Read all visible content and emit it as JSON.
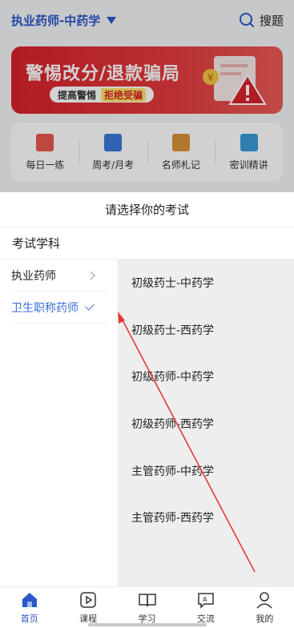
{
  "header": {
    "exam_title": "执业药师-中药学",
    "search_label": "搜题"
  },
  "banner": {
    "title": "警惕改分/退款骗局",
    "pill_text": "提高警惕",
    "pill_highlight": "拒绝受骗"
  },
  "quick_menu": [
    {
      "label": "每日一练",
      "icon": "calendar-practice-icon",
      "color": "#e8584e"
    },
    {
      "label": "周考/月考",
      "icon": "mock-exam-icon",
      "color": "#3a78d8"
    },
    {
      "label": "名师札记",
      "icon": "notes-book-icon",
      "color": "#d9923a"
    },
    {
      "label": "密训精讲",
      "icon": "lecture-icon",
      "color": "#3a9ad8"
    }
  ],
  "sheet": {
    "title": "请选择你的考试",
    "section_title": "考试学科",
    "categories": [
      {
        "label": "执业药师",
        "state": "collapsed"
      },
      {
        "label": "卫生职称药师",
        "state": "selected"
      }
    ],
    "exams": [
      "初级药士-中药学",
      "初级药士-西药学",
      "初级药师-中药学",
      "初级药师-西药学",
      "主管药师-中药学",
      "主管药师-西药学"
    ]
  },
  "tabbar": [
    {
      "label": "首页",
      "icon": "home-icon",
      "active": true
    },
    {
      "label": "课程",
      "icon": "play-course-icon",
      "active": false
    },
    {
      "label": "学习",
      "icon": "open-book-icon",
      "active": false
    },
    {
      "label": "交流",
      "icon": "chat-icon",
      "active": false
    },
    {
      "label": "我的",
      "icon": "person-icon",
      "active": false
    }
  ],
  "colors": {
    "accent": "#2a58c9",
    "selected": "#3b6fd9",
    "banner_red": "#d8232a",
    "annotation_red": "#e53935"
  }
}
